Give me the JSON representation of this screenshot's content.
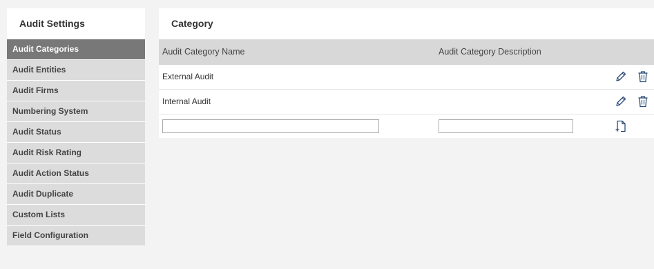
{
  "sidebar": {
    "title": "Audit Settings",
    "items": [
      {
        "label": "Audit Categories",
        "active": true
      },
      {
        "label": "Audit Entities"
      },
      {
        "label": "Audit Firms"
      },
      {
        "label": "Numbering System"
      },
      {
        "label": "Audit Status"
      },
      {
        "label": "Audit Risk Rating"
      },
      {
        "label": "Audit Action Status"
      },
      {
        "label": "Audit Duplicate"
      },
      {
        "label": "Custom Lists"
      },
      {
        "label": "Field Configuration"
      }
    ]
  },
  "panel": {
    "title": "Category",
    "columns": {
      "name": "Audit Category Name",
      "description": "Audit Category Description"
    },
    "rows": [
      {
        "name": "External Audit",
        "description": ""
      },
      {
        "name": "Internal Audit",
        "description": ""
      }
    ],
    "new_row": {
      "name_value": "",
      "description_value": ""
    },
    "icons": {
      "edit": "pencil-icon",
      "delete": "trash-icon",
      "add": "add-file-icon"
    }
  },
  "colors": {
    "active_item": "#787878",
    "inactive_item": "#dcdcdc",
    "table_header": "#d8d8d8",
    "page_background": "#f3f3f3",
    "icon": "#2b4a78"
  }
}
